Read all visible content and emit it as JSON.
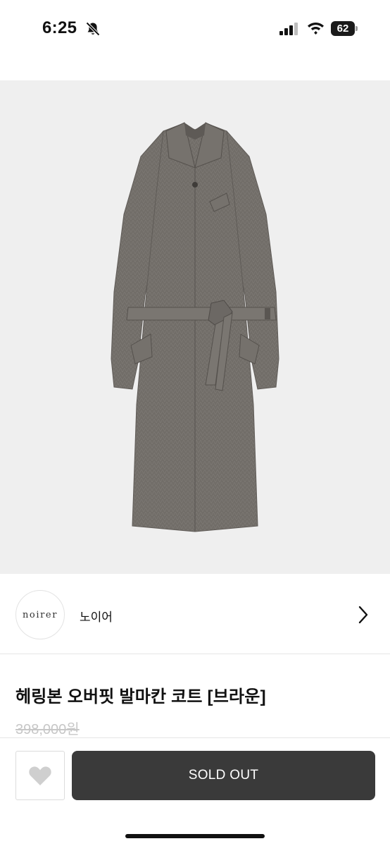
{
  "status_bar": {
    "time": "6:25",
    "battery_percent": "62",
    "icons": [
      "bell-slash-icon",
      "signal-icon",
      "wifi-icon",
      "battery-icon"
    ]
  },
  "product_image": {
    "background_color": "#efefef",
    "coat_color": "#6f6b66"
  },
  "brand": {
    "logo_text": "noirer",
    "name": "노이어",
    "chevron_icon": "chevron-right-icon"
  },
  "product": {
    "title": "헤링본 오버핏 발마칸 코트 [브라운]",
    "price": "398,000원"
  },
  "actions": {
    "wishlist_icon": "heart-icon",
    "soldout_label": "SOLD OUT",
    "button_color": "#3a3a3a"
  }
}
